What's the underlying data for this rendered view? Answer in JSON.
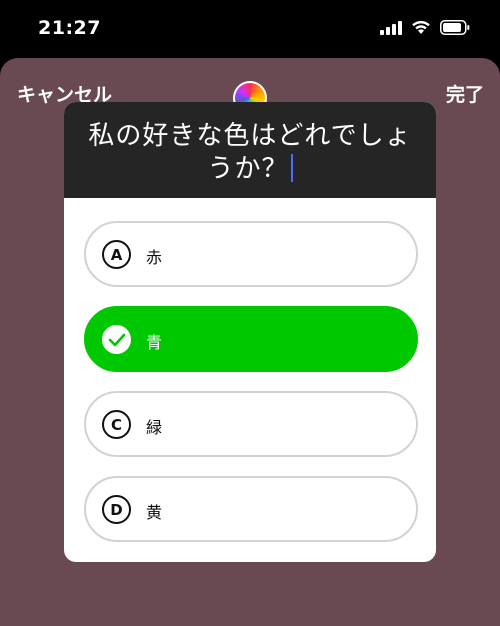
{
  "status_bar": {
    "time": "21:27",
    "icons": [
      "signal-icon",
      "wifi-icon",
      "battery-icon"
    ]
  },
  "toolbar": {
    "cancel_label": "キャンセル",
    "done_label": "完了",
    "color_picker_icon": "color-wheel-icon"
  },
  "quiz": {
    "question": "私の好きな色はどれでしょうか？",
    "options": [
      {
        "badge": "A",
        "label": "赤",
        "selected": false
      },
      {
        "badge": "check-icon",
        "label": "青",
        "selected": true
      },
      {
        "badge": "C",
        "label": "緑",
        "selected": false
      },
      {
        "badge": "D",
        "label": "黄",
        "selected": false
      }
    ]
  },
  "colors": {
    "sheet_background": "#6a4a52",
    "header_background": "#252525",
    "selected_option": "#00c800",
    "cursor": "#4a6cf7"
  }
}
